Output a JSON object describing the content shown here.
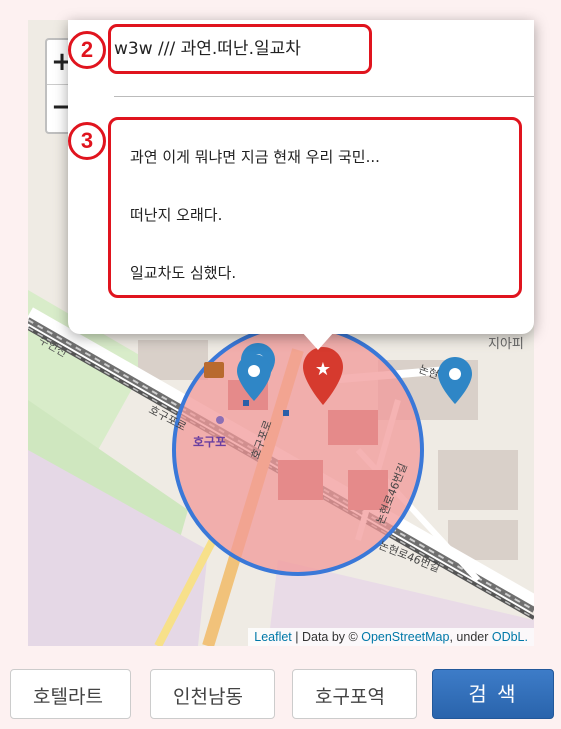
{
  "map": {
    "zoom_in": "+",
    "zoom_out": "−",
    "labels": {
      "suinseon": "수인선",
      "hoguporo": "호구포로",
      "hogupo": "호구포",
      "hogupo_road": "호구포로",
      "nonhyeonro_46": "논현로46번길",
      "nonhyeonro_46_2": "논현로46번길",
      "nonhyeon": "논현",
      "jiapi": "지아피"
    }
  },
  "popup": {
    "title": "w3w /// 과연.떠난.일교차",
    "lines": [
      "과연 이게 뭐냐면 지금 현재 우리 국민...",
      "떠난지 오래다.",
      "일교차도 심했다."
    ],
    "badges": [
      "2",
      "3"
    ]
  },
  "attribution": {
    "leaflet": "Leaflet",
    "sep": " | Data by © ",
    "osm": "OpenStreetMap",
    "under": ", under ",
    "odbl": "ODbL."
  },
  "search": {
    "word1": "호텔라트",
    "word2": "인천남동",
    "word3": "호구포역",
    "button": "검 색"
  },
  "colors": {
    "highlight": "#e0141e",
    "circle_stroke": "#3a78d8",
    "circle_fill": "#f29a9a",
    "marker_blue": "#2f86c6",
    "marker_red": "#d63a2e",
    "button": "#2f6db5"
  }
}
